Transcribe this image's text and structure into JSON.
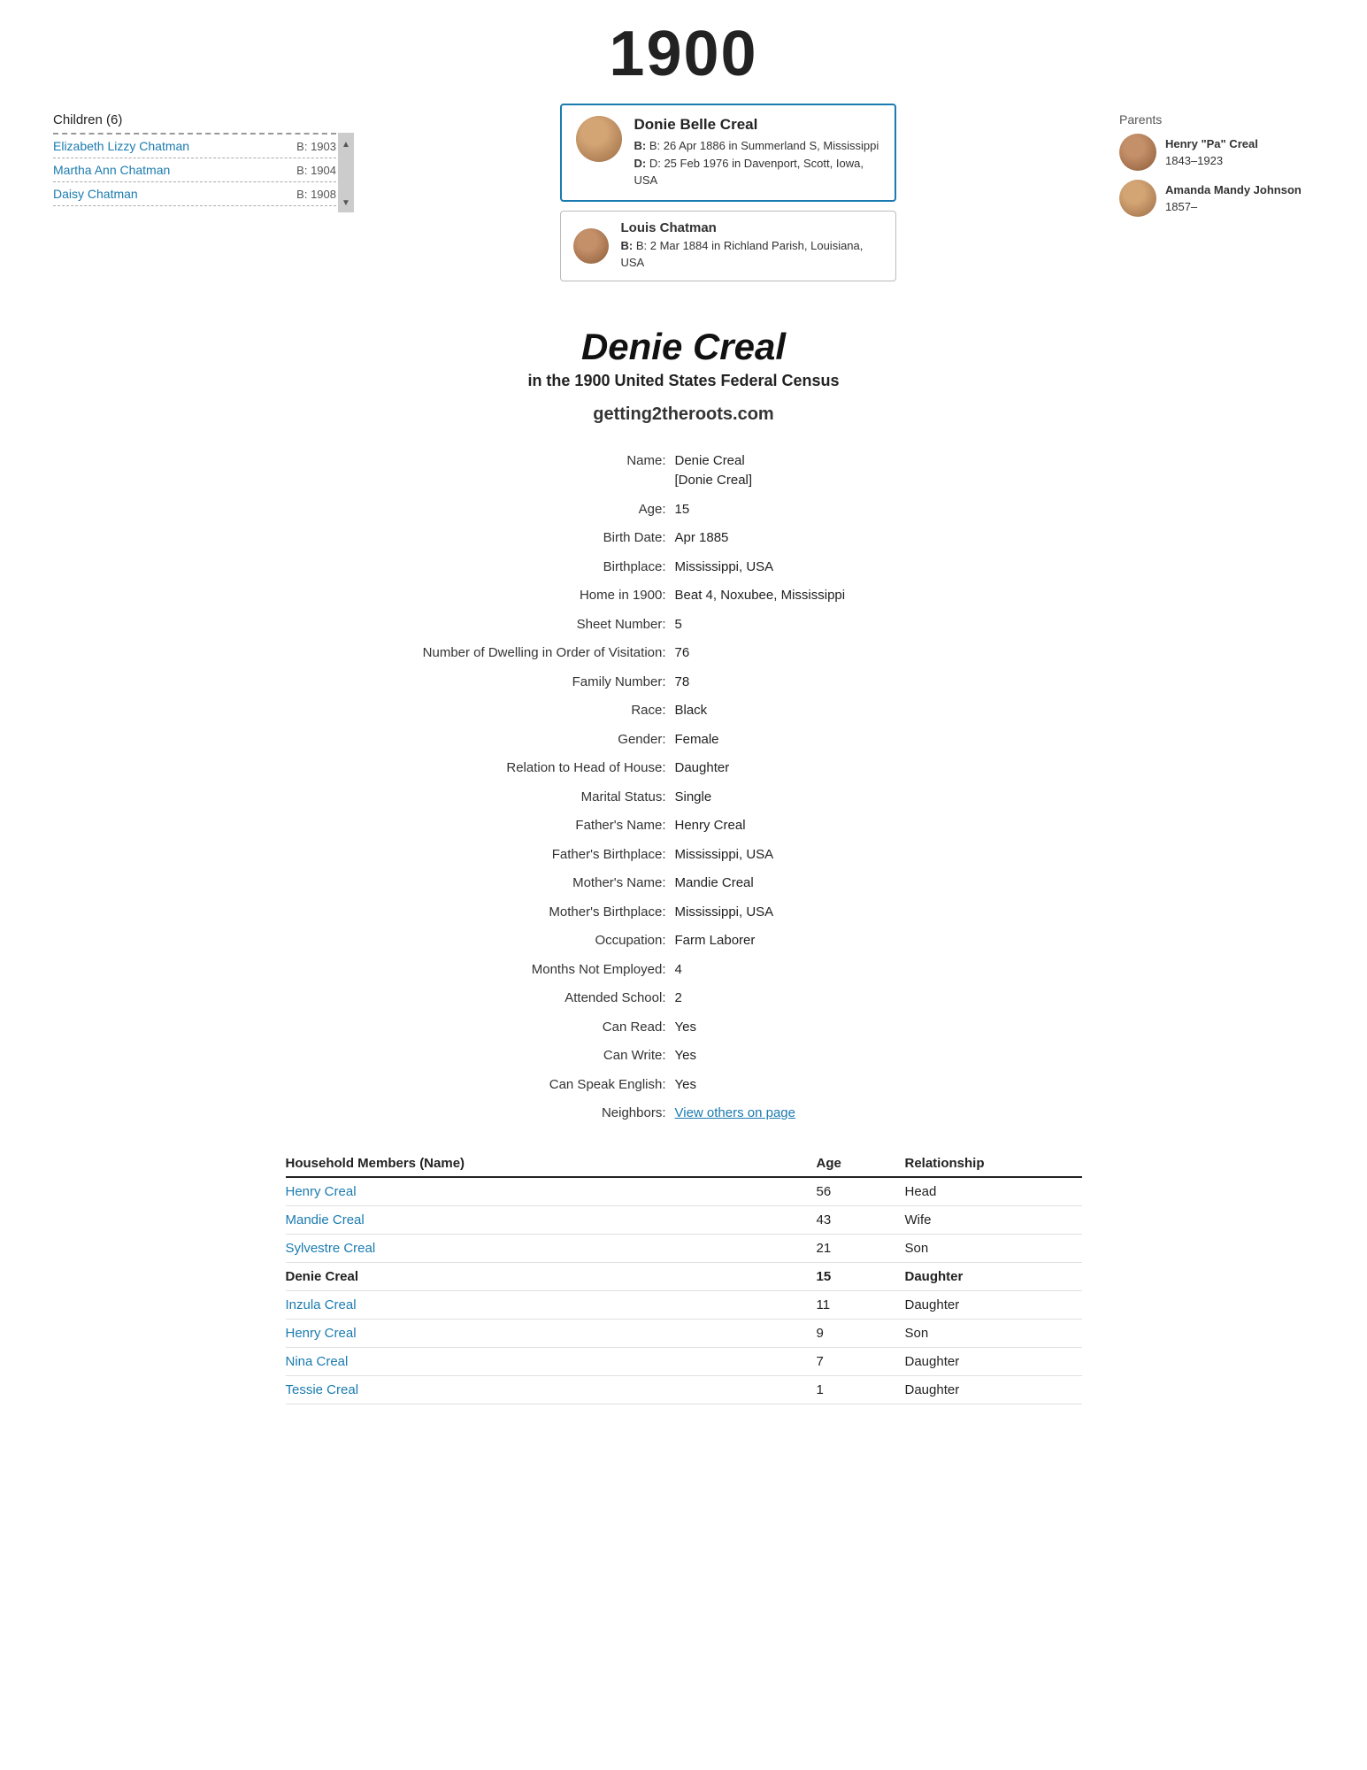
{
  "year": "1900",
  "children": {
    "title": "Children (6)",
    "items": [
      {
        "name": "Elizabeth Lizzy Chatman",
        "birth": "B: 1903"
      },
      {
        "name": "Martha Ann Chatman",
        "birth": "B: 1904"
      },
      {
        "name": "Daisy Chatman",
        "birth": "B: 1908"
      }
    ]
  },
  "primary_person": {
    "name": "Donie Belle Creal",
    "birth": "B: 26 Apr 1886 in Summerland S, Mississippi",
    "death": "D: 25 Feb 1976 in Davenport, Scott, Iowa, USA"
  },
  "secondary_person": {
    "name": "Louis Chatman",
    "birth": "B: 2 Mar 1884 in Richland Parish, Louisiana, USA"
  },
  "parents": {
    "title": "Parents",
    "items": [
      {
        "name": "Henry \"Pa\" Creal",
        "years": "1843–1923"
      },
      {
        "name": "Amanda Mandy Johnson",
        "years": "1857–"
      }
    ]
  },
  "page_title": "Denie Creal",
  "page_subtitle": "in the 1900 United States Federal Census",
  "website": "getting2theroots.com",
  "details": [
    {
      "label": "Name:",
      "value": "Denie Creal\n[Donie Creal]",
      "link": false
    },
    {
      "label": "Age:",
      "value": "15",
      "link": false
    },
    {
      "label": "Birth Date:",
      "value": "Apr 1885",
      "link": false
    },
    {
      "label": "Birthplace:",
      "value": "Mississippi, USA",
      "link": false
    },
    {
      "label": "Home in 1900:",
      "value": "Beat 4, Noxubee, Mississippi",
      "link": false
    },
    {
      "label": "Sheet Number:",
      "value": "5",
      "link": false
    },
    {
      "label": "Number of Dwelling in Order of Visitation:",
      "value": "76",
      "link": false
    },
    {
      "label": "Family Number:",
      "value": "78",
      "link": false
    },
    {
      "label": "Race:",
      "value": "Black",
      "link": false
    },
    {
      "label": "Gender:",
      "value": "Female",
      "link": false
    },
    {
      "label": "Relation to Head of House:",
      "value": "Daughter",
      "link": false
    },
    {
      "label": "Marital Status:",
      "value": "Single",
      "link": false
    },
    {
      "label": "Father's Name:",
      "value": "Henry Creal",
      "link": false
    },
    {
      "label": "Father's Birthplace:",
      "value": "Mississippi, USA",
      "link": false
    },
    {
      "label": "Mother's Name:",
      "value": "Mandie Creal",
      "link": false
    },
    {
      "label": "Mother's Birthplace:",
      "value": "Mississippi, USA",
      "link": false
    },
    {
      "label": "Occupation:",
      "value": "Farm Laborer",
      "link": false
    },
    {
      "label": "Months Not Employed:",
      "value": "4",
      "link": false
    },
    {
      "label": "Attended School:",
      "value": "2",
      "link": false
    },
    {
      "label": "Can Read:",
      "value": "Yes",
      "link": false
    },
    {
      "label": "Can Write:",
      "value": "Yes",
      "link": false
    },
    {
      "label": "Can Speak English:",
      "value": "Yes",
      "link": false
    },
    {
      "label": "Neighbors:",
      "value": "View others on page",
      "link": true
    }
  ],
  "household": {
    "headers": [
      "Household Members (Name)",
      "Age",
      "Relationship"
    ],
    "members": [
      {
        "name": "Henry Creal",
        "age": "56",
        "relationship": "Head",
        "current": false,
        "link": true
      },
      {
        "name": "Mandie Creal",
        "age": "43",
        "relationship": "Wife",
        "current": false,
        "link": true
      },
      {
        "name": "Sylvestre Creal",
        "age": "21",
        "relationship": "Son",
        "current": false,
        "link": true
      },
      {
        "name": "Denie Creal",
        "age": "15",
        "relationship": "Daughter",
        "current": true,
        "link": false
      },
      {
        "name": "Inzula Creal",
        "age": "11",
        "relationship": "Daughter",
        "current": false,
        "link": true
      },
      {
        "name": "Henry Creal",
        "age": "9",
        "relationship": "Son",
        "current": false,
        "link": true
      },
      {
        "name": "Nina Creal",
        "age": "7",
        "relationship": "Daughter",
        "current": false,
        "link": true
      },
      {
        "name": "Tessie Creal",
        "age": "1",
        "relationship": "Daughter",
        "current": false,
        "link": true
      }
    ]
  }
}
